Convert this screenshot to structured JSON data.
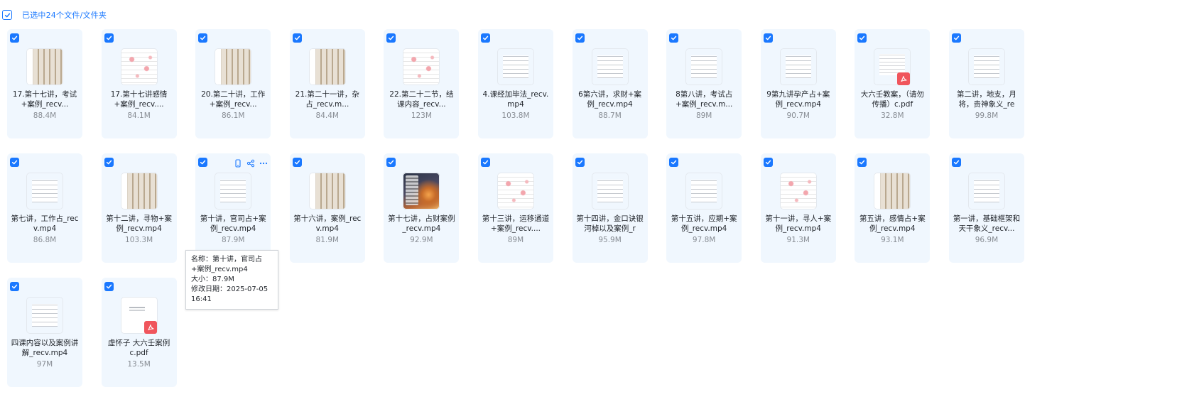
{
  "header": {
    "selection_text": "已选中24个文件/文件夹"
  },
  "colors": {
    "accent": "#1a78ff",
    "tile_bg": "#f0f7fe",
    "pdf": "#f0555c"
  },
  "files": [
    {
      "name": "17.第十七讲，考试+案例_recv...",
      "size": "88.4M",
      "thumb": "chart",
      "pdf": false
    },
    {
      "name": "17.第十七讲感情+案例_recv....",
      "size": "84.1M",
      "thumb": "pink",
      "pdf": false
    },
    {
      "name": "20.第二十讲，工作+案例_recv...",
      "size": "86.1M",
      "thumb": "chart",
      "pdf": false
    },
    {
      "name": "21.第二十一讲，杂占_recv.m...",
      "size": "84.4M",
      "thumb": "chart",
      "pdf": false
    },
    {
      "name": "22.第二十二节，结课内容_recv...",
      "size": "123M",
      "thumb": "pink",
      "pdf": false
    },
    {
      "name": "4.课经加毕法_recv.mp4",
      "size": "103.8M",
      "thumb": "doc",
      "pdf": false
    },
    {
      "name": "6第六讲，求财+案例_recv.mp4",
      "size": "88.7M",
      "thumb": "doc",
      "pdf": false
    },
    {
      "name": "8第八讲，考试占+案例_recv.m...",
      "size": "89M",
      "thumb": "doc",
      "pdf": false
    },
    {
      "name": "9第九讲孕产占+案例_recv.mp4",
      "size": "90.7M",
      "thumb": "doc",
      "pdf": false
    },
    {
      "name": "大六壬教案，（请勿传播）c.pdf",
      "size": "32.8M",
      "thumb": "pdfdoc",
      "pdf": true
    },
    {
      "name": "第二讲，地支，月将，贵神象义_re",
      "size": "99.8M",
      "thumb": "doc",
      "pdf": false
    },
    {
      "name": "第七讲，工作占_recv.mp4",
      "size": "86.8M",
      "thumb": "doc",
      "pdf": false
    },
    {
      "name": "第十二讲，寻物+案例_recv.mp4",
      "size": "103.3M",
      "thumb": "chart",
      "pdf": false
    },
    {
      "name": "第十讲，官司占+案例_recv.mp4",
      "size": "87.9M",
      "thumb": "doc",
      "pdf": false,
      "hover": true
    },
    {
      "name": "第十六讲，案例_recv.mp4",
      "size": "81.9M",
      "thumb": "chart",
      "pdf": false
    },
    {
      "name": "第十七讲，占财案例_recv.mp4",
      "size": "92.9M",
      "thumb": "photo",
      "pdf": false
    },
    {
      "name": "第十三讲，运移通道+案例_recv....",
      "size": "89M",
      "thumb": "pink",
      "pdf": false
    },
    {
      "name": "第十四讲，金口诀银河棹以及案例_r",
      "size": "95.9M",
      "thumb": "doc",
      "pdf": false
    },
    {
      "name": "第十五讲，应期+案例_recv.mp4",
      "size": "97.8M",
      "thumb": "doc",
      "pdf": false
    },
    {
      "name": "第十一讲，寻人+案例_recv.mp4",
      "size": "91.3M",
      "thumb": "pink",
      "pdf": false
    },
    {
      "name": "第五讲，感情占+案例_recv.mp4",
      "size": "93.1M",
      "thumb": "chart",
      "pdf": false
    },
    {
      "name": "第一讲，基础框架和天干象义_recv...",
      "size": "96.9M",
      "thumb": "doc",
      "pdf": false
    },
    {
      "name": "四课内容以及案例讲解_recv.mp4",
      "size": "97M",
      "thumb": "doc",
      "pdf": false
    },
    {
      "name": "虚怀子 大六壬案例c.pdf",
      "size": "13.5M",
      "thumb": "pdfblank",
      "pdf": true
    }
  ],
  "tooltip": {
    "name_line": "名称：第十讲，官司占+案例_recv.mp4",
    "size_line": "大小：87.9M",
    "date_line": "修改日期：2025-07-05 16:41"
  }
}
